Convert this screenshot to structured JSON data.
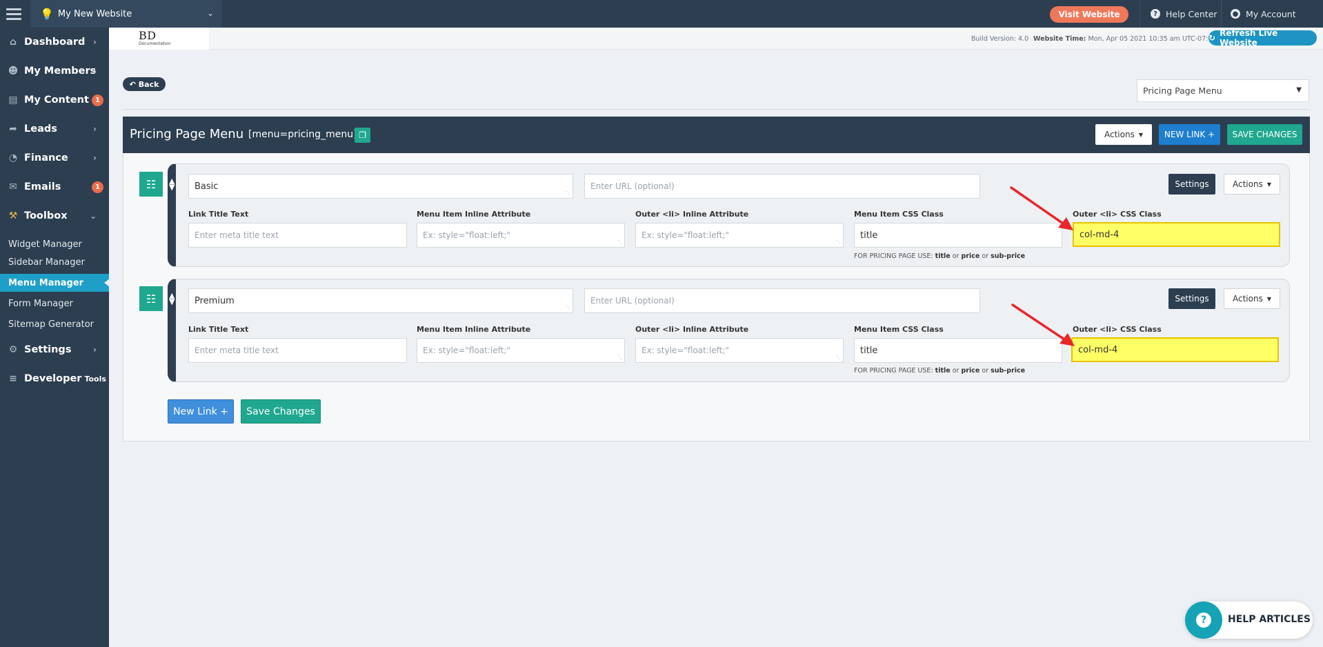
{
  "topbar": {
    "site_name": "My New Website",
    "visit_label": "Visit Website",
    "help_center": "Help Center",
    "my_account": "My Account"
  },
  "sidebar": {
    "items": [
      {
        "label": "Dashboard",
        "icon": "home-icon"
      },
      {
        "label": "My Members",
        "icon": "users-icon"
      },
      {
        "label": "My Content",
        "icon": "folder-icon",
        "badge": "1"
      },
      {
        "label": "Leads",
        "icon": "share-icon"
      },
      {
        "label": "Finance",
        "icon": "pie-chart-icon"
      },
      {
        "label": "Emails",
        "icon": "inbox-icon",
        "badge": "1"
      },
      {
        "label": "Toolbox",
        "icon": "wrench-icon"
      }
    ],
    "toolbox_sub": [
      "Widget Manager",
      "Sidebar Manager",
      "Menu Manager",
      "Form Manager",
      "Sitemap Generator"
    ],
    "settings": "Settings",
    "developer": "Developer",
    "developer_small": "Tools"
  },
  "subheader": {
    "logo_text": "BD",
    "logo_sub": "Documentation",
    "build_version": "Build Version: 4.0",
    "website_time_label": "Website Time:",
    "website_time_value": "Mon, Apr 05 2021 10:35 am UTC-07:00",
    "refresh_label": "Refresh Live Website"
  },
  "main": {
    "back_label": "Back",
    "menu_dropdown_value": "Pricing Page Menu",
    "panel_title": "Pricing Page Menu",
    "panel_code": "[menu=pricing_menu]",
    "actions_label": "Actions",
    "new_link_label": "NEW LINK +",
    "save_changes_label": "SAVE CHANGES",
    "bottom_new_link": "New Link +",
    "bottom_save": "Save Changes"
  },
  "labels": {
    "link_title_text": "Link Title Text",
    "menu_item_inline": "Menu Item Inline Attribute",
    "outer_li_inline": "Outer <li> Inline Attribute",
    "menu_item_css": "Menu Item CSS Class",
    "outer_li_css": "Outer <li> CSS Class",
    "url_placeholder": "Enter URL (optional)",
    "meta_placeholder": "Enter meta title text",
    "style_placeholder": "Ex: style=\"float:left;\"",
    "settings": "Settings",
    "actions": "Actions",
    "hint_prefix": "FOR PRICING PAGE USE:",
    "hint_title": "title",
    "hint_or": "or",
    "hint_price": "price",
    "hint_subprice": "sub-price"
  },
  "menu_items": [
    {
      "name": "Basic",
      "css_class": "title",
      "outer_css": "col-md-4"
    },
    {
      "name": "Premium",
      "css_class": "title",
      "outer_css": "col-md-4"
    }
  ],
  "help_widget": {
    "label": "HELP ARTICLES"
  },
  "colors": {
    "accent_teal": "#1fa88f",
    "dark_navy": "#2c3e50",
    "highlight_yellow": "#ffff66",
    "annotation_red": "#e8262b"
  }
}
